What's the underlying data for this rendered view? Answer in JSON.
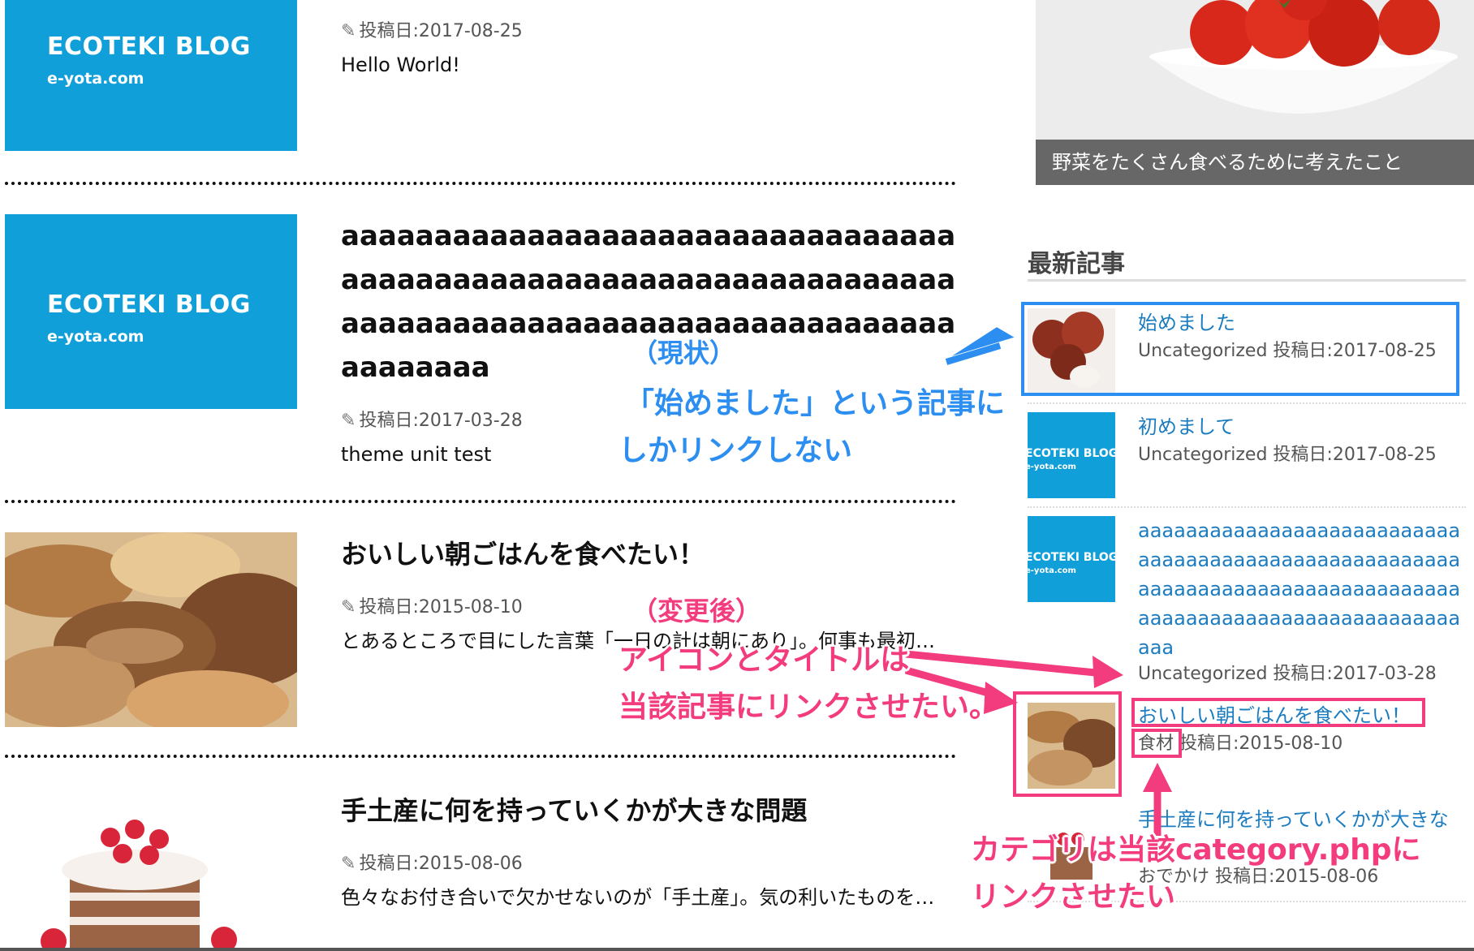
{
  "posts": [
    {
      "thumb": {
        "brand": "ECOTEKI BLOG",
        "domain": "e-yota.com"
      },
      "title": "",
      "date": "投稿日:2017-08-25",
      "excerpt": "Hello World!"
    },
    {
      "thumb": {
        "brand": "ECOTEKI BLOG",
        "domain": "e-yota.com"
      },
      "title": "aaaaaaaaaaaaaaaaaaaaaaaaaaaaaaaaaaaaaaaaaaaaaaaaaaaaaaaaaaaaaaaaaaaaaaaaaaaaaaaaaaaaaaaaaaaaaaaaaaaaaaaaaaa",
      "date": "投稿日:2017-03-28",
      "excerpt": "theme unit test"
    },
    {
      "thumb": {
        "image": "bread-photo"
      },
      "title": "おいしい朝ごはんを食べたい！",
      "date": "投稿日:2015-08-10",
      "excerpt": "とあるところで目にした言葉「一日の計は朝にあり」。何事も最初…"
    },
    {
      "thumb": {
        "image": "cake-photo"
      },
      "title": "手土産に何を持っていくかが大きな問題",
      "date": "投稿日:2015-08-06",
      "excerpt": "色々なお付き合いで欠かせないのが「手土産」。気の利いたものを…"
    }
  ],
  "sidebar": {
    "hero_caption": "野菜をたくさん食べるために考えたこと",
    "heading": "最新記事",
    "items": [
      {
        "title": "始めました",
        "category": "Uncategorized",
        "date": "投稿日:2017-08-25",
        "thumb": "lychee-photo"
      },
      {
        "title": "初めまして",
        "category": "Uncategorized",
        "date": "投稿日:2017-08-25",
        "thumb": {
          "brand": "ECOTEKI BLOG",
          "domain": "e-yota.com"
        }
      },
      {
        "title": "aaaaaaaaaaaaaaaaaaaaaaaaaaaaaaaaaaaaaaaaaaaaaaaaaaaaaaaaaaaaaaaaaaaaaaaaaaaaaaaaaaaaaaaaaaaaaaaaaaaaaaaaaaaaaaa",
        "category": "Uncategorized",
        "date": "投稿日:2017-03-28",
        "thumb": {
          "brand": "ECOTEKI BLOG",
          "domain": "e-yota.com"
        }
      },
      {
        "title": "おいしい朝ごはんを食べたい！",
        "category": "食材",
        "date": "投稿日:2015-08-10",
        "thumb": "bread-photo"
      },
      {
        "title": "手土産に何を持っていくかが大きな",
        "category": "おでかけ",
        "date": "投稿日:2015-08-06",
        "thumb": "cake-photo"
      }
    ]
  },
  "annotations": {
    "current_label": "（現状）",
    "current_line1": "「始めました」という記事に",
    "current_line2": "しかリンクしない",
    "after_label": "（変更後）",
    "after_line1": "アイコンとタイトルは",
    "after_line2": "当該記事にリンクさせたい。",
    "category_line1": "カテゴリは当該category.phpに",
    "category_line2": "リンクさせたい"
  },
  "colors": {
    "brand_blue": "#119fda",
    "link_blue": "#1c7cc0",
    "annotation_blue": "#2b8ef0",
    "annotation_pink": "#f33c7e"
  },
  "icons": {
    "date_icon": "pencil-icon"
  }
}
